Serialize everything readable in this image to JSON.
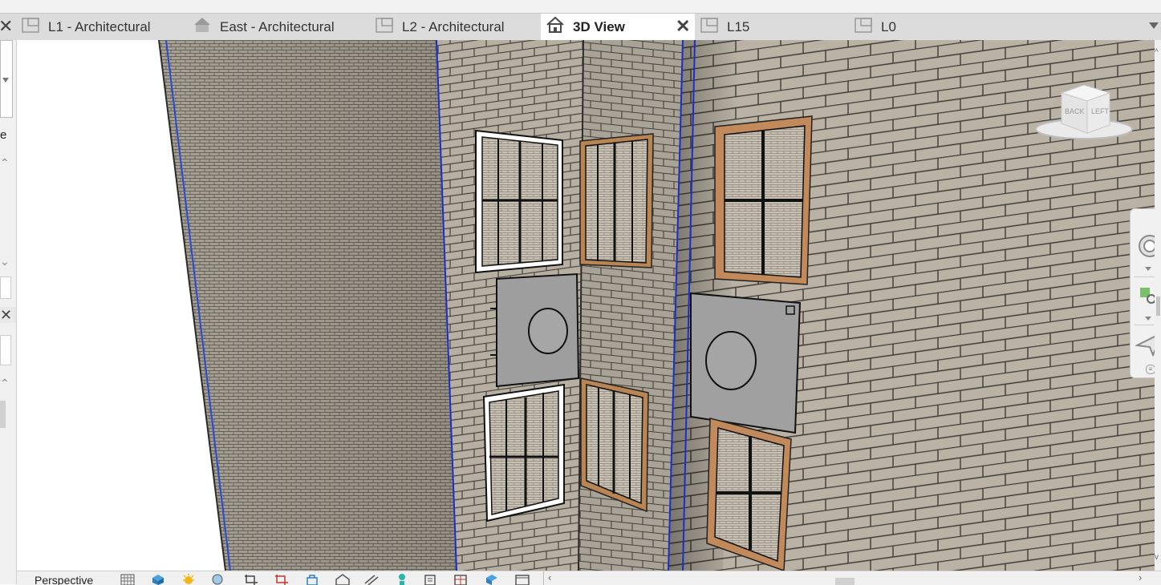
{
  "tabs": [
    {
      "label": "L1 - Architectural",
      "icon": "floor-plan-icon",
      "active": false
    },
    {
      "label": "East - Architectural",
      "icon": "elevation-icon",
      "active": false
    },
    {
      "label": "L2 - Architectural",
      "icon": "floor-plan-icon",
      "active": false
    },
    {
      "label": "3D View",
      "icon": "house-3d-icon",
      "active": true
    },
    {
      "label": "L15",
      "icon": "floor-plan-icon",
      "active": false
    },
    {
      "label": "L0",
      "icon": "floor-plan-icon",
      "active": false
    }
  ],
  "left_panel": {
    "cut_text": "e"
  },
  "viewcube": {
    "face_back": "BACK",
    "face_left": "LEFT"
  },
  "navigation_bar": {
    "tools": [
      "steering-wheel-icon",
      "zoom-region-icon",
      "fly-navigation-icon"
    ]
  },
  "status_bar": {
    "view_mode": "Perspective",
    "icons": [
      "visual-style-icon",
      "render-3d-icon",
      "sun-path-icon",
      "shadows-icon",
      "crop-view-icon",
      "show-crop-region-icon",
      "unlock-view-icon",
      "temporary-hide-icon",
      "reveal-hidden-icon",
      "analysis-display-icon",
      "lock-3d-icon",
      "highlight-displacement-icon",
      "reveal-constraints-icon",
      "section-box-icon"
    ]
  },
  "colors": {
    "brick": "#b2ab9e",
    "mortar": "#45423c",
    "tab_bar": "#dcdcdc",
    "active_tab": "#ffffff",
    "frame_wood": "#b98553",
    "ac_unit": "#9e9e9e"
  }
}
